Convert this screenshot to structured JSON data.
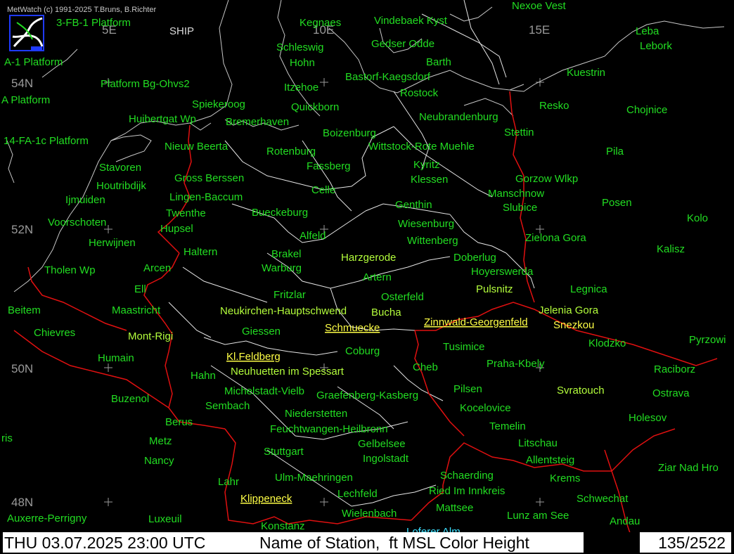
{
  "header": {
    "copyright": "MetWatch  (c) 1991-2025 T.Bruns, B.Richter",
    "ship_label": "SHIP"
  },
  "grid": {
    "longitudes": [
      "5E",
      "10E",
      "15E"
    ],
    "latitudes": [
      "54N",
      "52N",
      "50N",
      "48N"
    ]
  },
  "colors": {
    "green": "#22dd22",
    "yellowgreen": "#b4ff3c",
    "yellow": "#ffff46",
    "cyan": "#3ce0ff",
    "coastline": "#c8c8c8",
    "region_lines": "#e6e6e6",
    "borders": "#e01010"
  },
  "stations": [
    {
      "name": "Nexoe Vest",
      "tier": "green",
      "underline": false
    },
    {
      "name": "3-FB-1 Platform",
      "tier": "green",
      "underline": false
    },
    {
      "name": "Kegnaes",
      "tier": "green",
      "underline": false
    },
    {
      "name": "Vindebaek Kyst",
      "tier": "green",
      "underline": false
    },
    {
      "name": "Leba",
      "tier": "green",
      "underline": false
    },
    {
      "name": "Lebork",
      "tier": "green",
      "underline": false
    },
    {
      "name": "A-1 Platform",
      "tier": "green",
      "underline": false
    },
    {
      "name": "Schleswig",
      "tier": "green",
      "underline": false
    },
    {
      "name": "Gedser Odde",
      "tier": "green",
      "underline": false
    },
    {
      "name": "Hohn",
      "tier": "green",
      "underline": false
    },
    {
      "name": "Barth",
      "tier": "green",
      "underline": false
    },
    {
      "name": "Kuestrin",
      "tier": "green",
      "underline": false
    },
    {
      "name": "Platform Bg-Ohvs2",
      "tier": "green",
      "underline": false
    },
    {
      "name": "Bastorf-Kaegsdorf",
      "tier": "green",
      "underline": false
    },
    {
      "name": "Itzehoe",
      "tier": "green",
      "underline": false
    },
    {
      "name": "Rostock",
      "tier": "green",
      "underline": false
    },
    {
      "name": "A Platform",
      "tier": "green",
      "underline": false
    },
    {
      "name": "Spiekeroog",
      "tier": "green",
      "underline": false
    },
    {
      "name": "Quickborn",
      "tier": "green",
      "underline": false
    },
    {
      "name": "Resko",
      "tier": "green",
      "underline": false
    },
    {
      "name": "Chojnice",
      "tier": "green",
      "underline": false
    },
    {
      "name": "Huibertgat Wp",
      "tier": "green",
      "underline": false
    },
    {
      "name": "Bremerhaven",
      "tier": "green",
      "underline": false
    },
    {
      "name": "Neubrandenburg",
      "tier": "green",
      "underline": false
    },
    {
      "name": "Boizenburg",
      "tier": "green",
      "underline": false
    },
    {
      "name": "Stettin",
      "tier": "green",
      "underline": false
    },
    {
      "name": "14-FA-1c Platform",
      "tier": "green",
      "underline": false
    },
    {
      "name": "Nieuw Beerta",
      "tier": "green",
      "underline": false
    },
    {
      "name": "Wittstock-Rote Muehle",
      "tier": "green",
      "underline": false
    },
    {
      "name": "Rotenburg",
      "tier": "green",
      "underline": false
    },
    {
      "name": "Pila",
      "tier": "green",
      "underline": false
    },
    {
      "name": "Kyritz",
      "tier": "green",
      "underline": false
    },
    {
      "name": "Stavoren",
      "tier": "green",
      "underline": false
    },
    {
      "name": "Fassberg",
      "tier": "green",
      "underline": false
    },
    {
      "name": "Gross Berssen",
      "tier": "green",
      "underline": false
    },
    {
      "name": "Klessen",
      "tier": "green",
      "underline": false
    },
    {
      "name": "Gorzow Wlkp",
      "tier": "green",
      "underline": false
    },
    {
      "name": "Houtribdijk",
      "tier": "green",
      "underline": false
    },
    {
      "name": "Celle",
      "tier": "green",
      "underline": false
    },
    {
      "name": "Manschnow",
      "tier": "green",
      "underline": false
    },
    {
      "name": "Lingen-Baccum",
      "tier": "green",
      "underline": false
    },
    {
      "name": "Ijmuiden",
      "tier": "green",
      "underline": false
    },
    {
      "name": "Posen",
      "tier": "green",
      "underline": false
    },
    {
      "name": "Genthin",
      "tier": "green",
      "underline": false
    },
    {
      "name": "Slubice",
      "tier": "green",
      "underline": false
    },
    {
      "name": "Bueckeburg",
      "tier": "green",
      "underline": false
    },
    {
      "name": "Twenthe",
      "tier": "green",
      "underline": false
    },
    {
      "name": "Kolo",
      "tier": "green",
      "underline": false
    },
    {
      "name": "Voorschoten",
      "tier": "green",
      "underline": false
    },
    {
      "name": "Wiesenburg",
      "tier": "green",
      "underline": false
    },
    {
      "name": "Hupsel",
      "tier": "green",
      "underline": false
    },
    {
      "name": "Alfeld",
      "tier": "green",
      "underline": false
    },
    {
      "name": "Zielona Gora",
      "tier": "green",
      "underline": false
    },
    {
      "name": "Wittenberg",
      "tier": "green",
      "underline": false
    },
    {
      "name": "Herwijnen",
      "tier": "green",
      "underline": false
    },
    {
      "name": "Kalisz",
      "tier": "green",
      "underline": false
    },
    {
      "name": "Haltern",
      "tier": "green",
      "underline": false
    },
    {
      "name": "Brakel",
      "tier": "green",
      "underline": false
    },
    {
      "name": "Harzgerode",
      "tier": "yellowgreen",
      "underline": false
    },
    {
      "name": "Doberlug",
      "tier": "green",
      "underline": false
    },
    {
      "name": "Tholen Wp",
      "tier": "green",
      "underline": false
    },
    {
      "name": "Arcen",
      "tier": "green",
      "underline": false
    },
    {
      "name": "Warburg",
      "tier": "green",
      "underline": false
    },
    {
      "name": "Hoyerswerda",
      "tier": "green",
      "underline": false
    },
    {
      "name": "Artern",
      "tier": "green",
      "underline": false
    },
    {
      "name": "Ell",
      "tier": "green",
      "underline": false
    },
    {
      "name": "Pulsnitz",
      "tier": "yellowgreen",
      "underline": false
    },
    {
      "name": "Legnica",
      "tier": "green",
      "underline": false
    },
    {
      "name": "Fritzlar",
      "tier": "green",
      "underline": false
    },
    {
      "name": "Osterfeld",
      "tier": "green",
      "underline": false
    },
    {
      "name": "Beitem",
      "tier": "green",
      "underline": false
    },
    {
      "name": "Maastricht",
      "tier": "green",
      "underline": false
    },
    {
      "name": "Neukirchen-Hauptschwend",
      "tier": "yellowgreen",
      "underline": false
    },
    {
      "name": "Bucha",
      "tier": "yellowgreen",
      "underline": false
    },
    {
      "name": "Jelenia Gora",
      "tier": "yellowgreen",
      "underline": false
    },
    {
      "name": "Zinnwald-Georgenfeld",
      "tier": "yellow",
      "underline": true
    },
    {
      "name": "Schmuecke",
      "tier": "yellow",
      "underline": true
    },
    {
      "name": "Snezkou",
      "tier": "yellow",
      "underline": false
    },
    {
      "name": "Chievres",
      "tier": "green",
      "underline": false
    },
    {
      "name": "Giessen",
      "tier": "green",
      "underline": false
    },
    {
      "name": "Mont-Rigi",
      "tier": "yellowgreen",
      "underline": false
    },
    {
      "name": "Klodzko",
      "tier": "green",
      "underline": false
    },
    {
      "name": "Pyrzowi",
      "tier": "green",
      "underline": false
    },
    {
      "name": "Tusimice",
      "tier": "green",
      "underline": false
    },
    {
      "name": "Coburg",
      "tier": "green",
      "underline": false
    },
    {
      "name": "Kl.Feldberg",
      "tier": "yellow",
      "underline": true
    },
    {
      "name": "Humain",
      "tier": "green",
      "underline": false
    },
    {
      "name": "Praha-Kbely",
      "tier": "green",
      "underline": false
    },
    {
      "name": "Cheb",
      "tier": "green",
      "underline": false
    },
    {
      "name": "Neuhuetten im Spessart",
      "tier": "yellowgreen",
      "underline": false
    },
    {
      "name": "Hahn",
      "tier": "green",
      "underline": false
    },
    {
      "name": "Raciborz",
      "tier": "green",
      "underline": false
    },
    {
      "name": "Pilsen",
      "tier": "green",
      "underline": false
    },
    {
      "name": "Michelstadt-Vielb",
      "tier": "green",
      "underline": false
    },
    {
      "name": "Svratouch",
      "tier": "yellowgreen",
      "underline": false
    },
    {
      "name": "Graefenberg-Kasberg",
      "tier": "green",
      "underline": false
    },
    {
      "name": "Ostrava",
      "tier": "green",
      "underline": false
    },
    {
      "name": "Buzenol",
      "tier": "green",
      "underline": false
    },
    {
      "name": "Sembach",
      "tier": "green",
      "underline": false
    },
    {
      "name": "Kocelovice",
      "tier": "green",
      "underline": false
    },
    {
      "name": "Niederstetten",
      "tier": "green",
      "underline": false
    },
    {
      "name": "Holesov",
      "tier": "green",
      "underline": false
    },
    {
      "name": "Berus",
      "tier": "green",
      "underline": false
    },
    {
      "name": "Temelin",
      "tier": "green",
      "underline": false
    },
    {
      "name": "Feuchtwangen-Heilbronn",
      "tier": "green",
      "underline": false
    },
    {
      "name": "ris",
      "tier": "green",
      "underline": false
    },
    {
      "name": "Metz",
      "tier": "green",
      "underline": false
    },
    {
      "name": "Gelbelsee",
      "tier": "green",
      "underline": false
    },
    {
      "name": "Litschau",
      "tier": "green",
      "underline": false
    },
    {
      "name": "Stuttgart",
      "tier": "green",
      "underline": false
    },
    {
      "name": "Nancy",
      "tier": "green",
      "underline": false
    },
    {
      "name": "Ingolstadt",
      "tier": "green",
      "underline": false
    },
    {
      "name": "Allentsteig",
      "tier": "green",
      "underline": false
    },
    {
      "name": "Ziar Nad Hro",
      "tier": "green",
      "underline": false
    },
    {
      "name": "Schaerding",
      "tier": "green",
      "underline": false
    },
    {
      "name": "Ulm-Maehringen",
      "tier": "green",
      "underline": false
    },
    {
      "name": "Krems",
      "tier": "green",
      "underline": false
    },
    {
      "name": "Lahr",
      "tier": "green",
      "underline": false
    },
    {
      "name": "Ried Im Innkreis",
      "tier": "green",
      "underline": false
    },
    {
      "name": "Lechfeld",
      "tier": "green",
      "underline": false
    },
    {
      "name": "Klippeneck",
      "tier": "yellow",
      "underline": true
    },
    {
      "name": "Schwechat",
      "tier": "green",
      "underline": false
    },
    {
      "name": "Mattsee",
      "tier": "green",
      "underline": false
    },
    {
      "name": "Auxerre-Perrigny",
      "tier": "green",
      "underline": false
    },
    {
      "name": "Wielenbach",
      "tier": "green",
      "underline": false
    },
    {
      "name": "Lunz am See",
      "tier": "green",
      "underline": false
    },
    {
      "name": "Luxeuil",
      "tier": "green",
      "underline": false
    },
    {
      "name": "Andau",
      "tier": "green",
      "underline": false
    },
    {
      "name": "Konstanz",
      "tier": "green",
      "underline": false
    },
    {
      "name": "Loferer Alm",
      "tier": "cyan",
      "underline": false
    }
  ],
  "status_bar": {
    "datetime": "THU 03.07.2025 23:00 UTC",
    "legend": "Name of Station,  ft MSL Color Height",
    "counter": "135/2522"
  }
}
